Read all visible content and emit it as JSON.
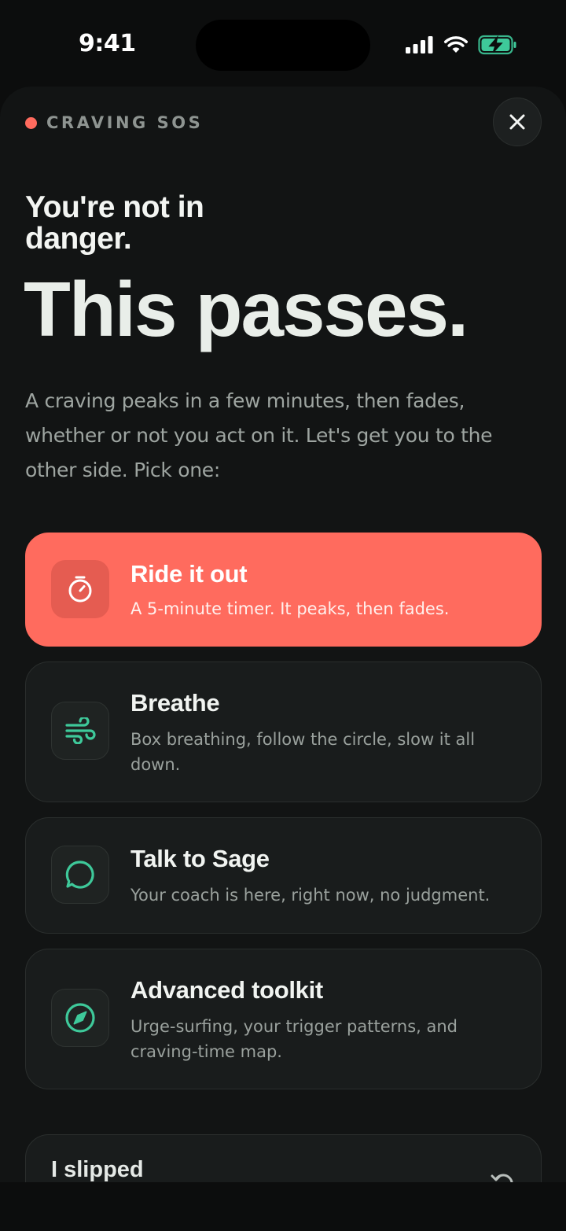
{
  "status_bar": {
    "time": "9:41",
    "icons": [
      "cellular-signal-icon",
      "wifi-icon",
      "battery-charging-icon"
    ]
  },
  "header": {
    "eyebrow": "CRAVING SOS",
    "close_icon": "close-icon"
  },
  "hero": {
    "subhead": "You're not in danger.",
    "headline": "This passes.",
    "intro": "A craving peaks in a few minutes, then fades, whether or not you act on it. Let's get you to the other side. Pick one:"
  },
  "options": [
    {
      "title": "Ride it out",
      "description": "A 5-minute timer. It peaks, then fades.",
      "icon": "timer-icon"
    },
    {
      "title": "Breathe",
      "description": "Box breathing, follow the circle, slow it all down.",
      "icon": "wind-icon"
    },
    {
      "title": "Talk to Sage",
      "description": "Your coach is here, right now, no judgment.",
      "icon": "chat-bubble-icon"
    },
    {
      "title": "Advanced toolkit",
      "description": "Urge-surfing, your trigger patterns, and craving-time map.",
      "icon": "compass-icon"
    }
  ],
  "slip": {
    "title": "I slipped",
    "icon": "undo-icon"
  },
  "colors": {
    "accent": "#ff6b5e",
    "icon_green": "#3ec99a",
    "background": "#0c0d0d",
    "sheet": "#121414"
  }
}
